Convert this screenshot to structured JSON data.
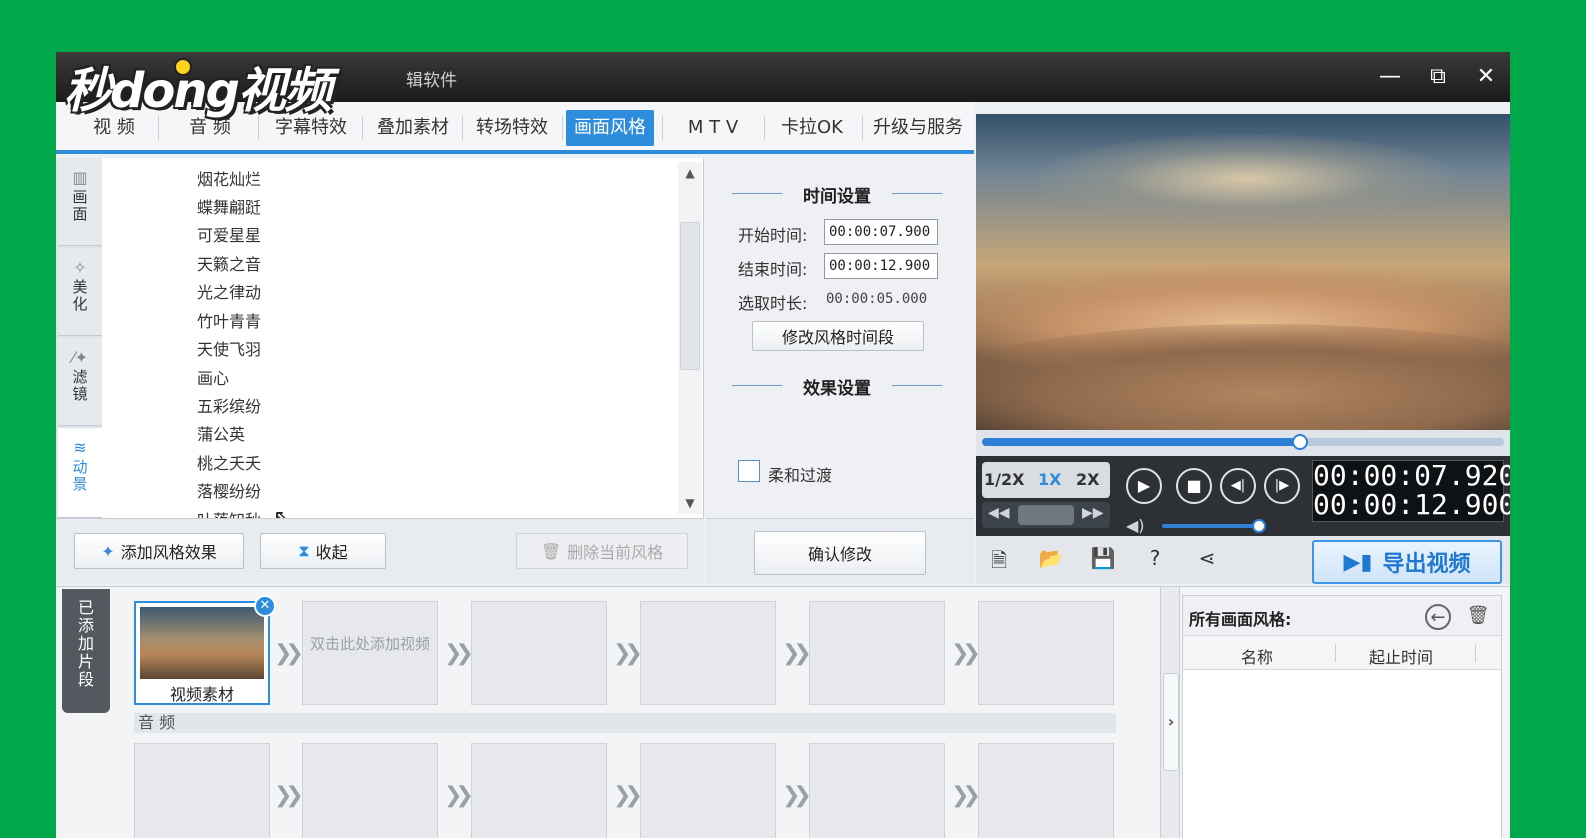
{
  "app": {
    "title": "辑软件"
  },
  "watermark": {
    "text": "秒dong视频"
  },
  "window_controls": {
    "minimize": "—",
    "restore": "⧉",
    "close": "✕"
  },
  "tabs": [
    {
      "label": "视 频"
    },
    {
      "label": "音 频"
    },
    {
      "label": "字幕特效"
    },
    {
      "label": "叠加素材"
    },
    {
      "label": "转场特效"
    },
    {
      "label": "画面风格",
      "active": true
    },
    {
      "label": "M T V"
    },
    {
      "label": "卡拉OK"
    },
    {
      "label": "升级与服务"
    }
  ],
  "side_tabs": [
    {
      "label": "画面",
      "icon": "film-icon"
    },
    {
      "label": "美化",
      "icon": "magic-icon"
    },
    {
      "label": "滤镜",
      "icon": "wand-icon"
    },
    {
      "label": "动景",
      "icon": "wave-icon",
      "active": true
    }
  ],
  "style_list": [
    "烟花灿烂",
    "蝶舞翩跹",
    "可爱星星",
    "天籁之音",
    "光之律动",
    "竹叶青青",
    "天使飞羽",
    "画心",
    "五彩缤纷",
    "蒲公英",
    "桃之夭夭",
    "落樱纷纷",
    "叶落知秋"
  ],
  "list_buttons": {
    "add": "添加风格效果",
    "collapse": "收起",
    "delete": "删除当前风格"
  },
  "settings": {
    "time_header": "时间设置",
    "start_label": "开始时间:",
    "start_value": "00:00:07.900",
    "end_label": "结束时间:",
    "end_value": "00:00:12.900",
    "duration_label": "选取时长:",
    "duration_value": "00:00:05.000",
    "modify_btn": "修改风格时间段",
    "effect_header": "效果设置",
    "smooth_label": "柔和过渡",
    "confirm_btn": "确认修改"
  },
  "player": {
    "progress": 0.61,
    "speeds": [
      "1/2X",
      "1X",
      "2X"
    ],
    "active_speed": "1X",
    "current_time": "00:00:07.920",
    "total_time": "00:00:12.900",
    "volume": 0.9
  },
  "export": {
    "label": "导出视频"
  },
  "timeline": {
    "tag": "已添加片段",
    "clip_label": "视频素材",
    "add_hint": "双击此处添加视频",
    "audio_label": "音 频"
  },
  "right_panel": {
    "title": "所有画面风格:",
    "col_name": "名称",
    "col_time": "起止时间"
  },
  "colors": {
    "accent": "#2d8cdc",
    "background": "#00a84a",
    "titlebar": "#1b1b1b"
  }
}
